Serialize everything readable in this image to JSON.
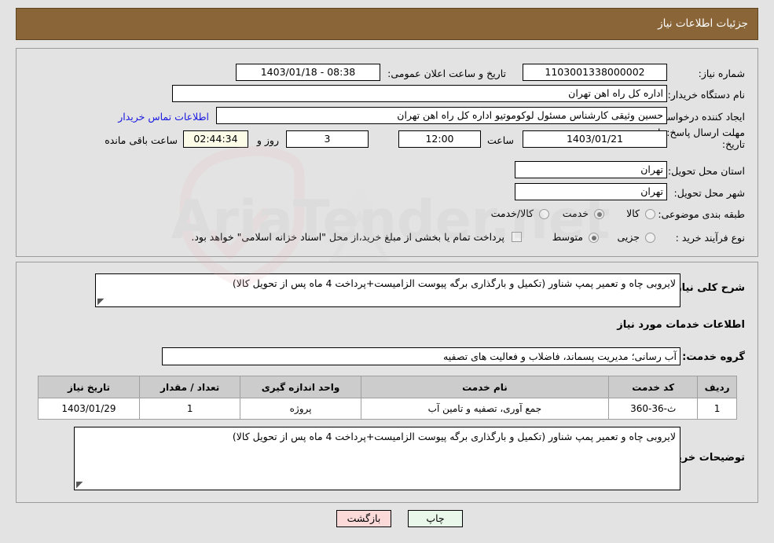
{
  "header": {
    "title": "جزئیات اطلاعات نیاز"
  },
  "form": {
    "need_number_label": "شماره نیاز:",
    "need_number_value": "1103001338000002",
    "announce_label": "تاریخ و ساعت اعلان عمومی:",
    "announce_value": "08:38 - 1403/01/18",
    "buyer_org_label": "نام دستگاه خریدار:",
    "buyer_org_value": "اداره کل راه اهن تهران",
    "creator_label": "ایجاد کننده درخواست:",
    "creator_value": "حسین وثیقی کارشناس مسئول لوکوموتیو اداره کل راه اهن تهران",
    "contact_link": "اطلاعات تماس خریدار",
    "deadline_label_line1": "مهلت ارسال پاسخ: تا",
    "deadline_label_line2": "تاریخ:",
    "deadline_date": "1403/01/21",
    "hour_label": "ساعت",
    "hour_value": "12:00",
    "days_value": "3",
    "days_suffix": "روز و",
    "timer_value": "02:44:34",
    "timer_suffix": "ساعت باقی مانده",
    "province_label": "استان محل تحویل:",
    "province_value": "تهران",
    "city_label": "شهر محل تحویل:",
    "city_value": "تهران",
    "category_label": "طبقه بندی موضوعی:",
    "category_options": [
      {
        "label": "کالا",
        "selected": false
      },
      {
        "label": "خدمت",
        "selected": true
      },
      {
        "label": "کالا/خدمت",
        "selected": false
      }
    ],
    "process_label": "نوع فرآیند خرید :",
    "process_options": [
      {
        "label": "جزیی",
        "selected": false
      },
      {
        "label": "متوسط",
        "selected": true
      }
    ],
    "treasury_checkbox_text": "پرداخت تمام یا بخشی از مبلغ خرید،از محل \"اسناد خزانه اسلامی\" خواهد بود.",
    "treasury_checked": false
  },
  "details": {
    "summary_label": "شرح کلی نیاز:",
    "summary_value": "لایروبی چاه و تعمیر پمپ شناور (تکمیل و بارگذاری برگه پیوست الزامیست+پرداخت 4 ماه پس از تحویل کالا)",
    "services_heading": "اطلاعات خدمات مورد نیاز",
    "service_group_label": "گروه خدمت:",
    "service_group_value": "آب رسانی؛ مدیریت پسماند، فاضلاب و فعالیت های تصفیه",
    "buyer_notes_label": "توضیحات خریدار:",
    "buyer_notes_value": "لایروبی چاه و تعمیر پمپ شناور (تکمیل و بارگذاری برگه پیوست الزامیست+پرداخت 4 ماه پس از تحویل کالا)"
  },
  "table": {
    "headers": [
      "ردیف",
      "کد خدمت",
      "نام خدمت",
      "واحد اندازه گیری",
      "تعداد / مقدار",
      "تاریخ نیاز"
    ],
    "rows": [
      [
        "1",
        "ث-36-360",
        "جمع آوری، تصفیه و تامین آب",
        "پروژه",
        "1",
        "1403/01/29"
      ]
    ]
  },
  "buttons": {
    "print": "چاپ",
    "back": "بازگشت"
  },
  "watermark": {
    "text": "AriaTender.net"
  },
  "colors": {
    "header_bg": "#8a6538",
    "page_bg": "#e3e3e3",
    "link": "#1818e0",
    "timer_bg": "#fbfbe8",
    "print_bg": "#e9f7ea",
    "back_bg": "#fbd9d9"
  }
}
